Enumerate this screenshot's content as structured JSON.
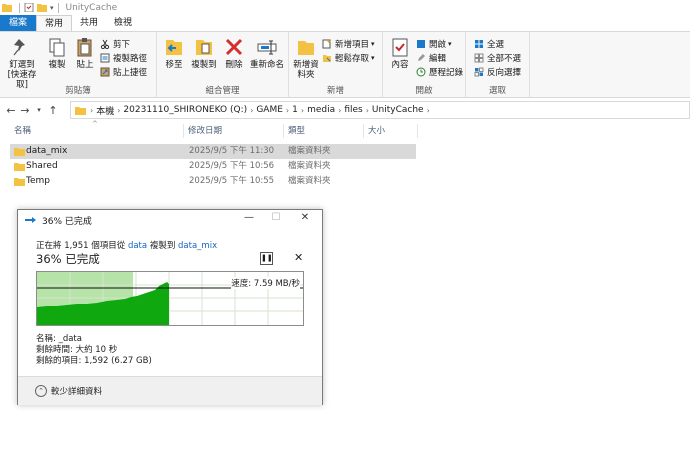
{
  "window": {
    "title": "UnityCache"
  },
  "ribbon_tabs": [
    "檔案",
    "常用",
    "共用",
    "檢視"
  ],
  "ribbon": {
    "clipboard": {
      "pin": "釘選到 [快速存取]",
      "copy": "複製",
      "paste": "貼上",
      "cut": "剪下",
      "copy_path": "複製路徑",
      "paste_shortcut": "貼上捷徑",
      "label": "剪貼簿"
    },
    "organize": {
      "move_to": "移至",
      "copy_to": "複製到",
      "delete": "刪除",
      "rename": "重新命名",
      "label": "組合管理"
    },
    "new": {
      "new_folder": "新增資料夾",
      "new_item": "新增項目",
      "easy_access": "輕鬆存取",
      "label": "新增"
    },
    "open": {
      "properties": "內容",
      "open": "開啟",
      "edit": "編輯",
      "history": "歷程記錄",
      "label": "開啟"
    },
    "select": {
      "select_all": "全選",
      "select_none": "全部不選",
      "invert": "反向選擇",
      "label": "選取"
    }
  },
  "breadcrumb": [
    "本機",
    "20231110_SHIRONEKO (Q:)",
    "GAME",
    "1",
    "media",
    "files",
    "UnityCache"
  ],
  "columns": [
    "名稱",
    "修改日期",
    "類型",
    "大小"
  ],
  "files": [
    {
      "name": "data_mix",
      "date": "2025/9/5 下午 11:30",
      "type": "檔案資料夾"
    },
    {
      "name": "Shared",
      "date": "2025/9/5 下午 10:56",
      "type": "檔案資料夾"
    },
    {
      "name": "Temp",
      "date": "2025/9/5 下午 10:55",
      "type": "檔案資料夾"
    }
  ],
  "dialog": {
    "title": "36% 已完成",
    "copy_prefix": "正在將 1,951 個項目從",
    "source": "data",
    "copy_mid": "複製到",
    "dest": "data_mix",
    "percent_text": "36% 已完成",
    "progress_fraction": 0.36,
    "speed": "速度: 7.59 MB/秒",
    "name_line": "名稱:  _data",
    "time_line": "剩餘時間: 大約 10 秒",
    "items_line": "剩餘的項目: 1,592 (6.27 GB)",
    "collapse_label": "較少詳細資料"
  },
  "colors": {
    "accent": "#1979ca",
    "progress_fill": "#b6e3a8",
    "graph_green": "#0fa80f",
    "link": "#1565c0"
  }
}
